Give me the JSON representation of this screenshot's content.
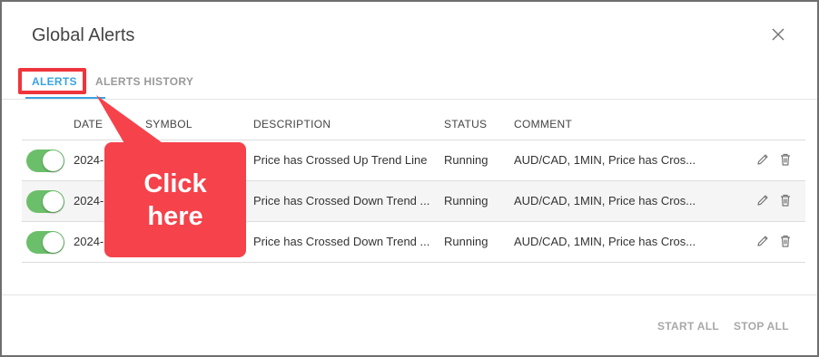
{
  "dialog": {
    "title": "Global Alerts"
  },
  "tabs": [
    {
      "label": "ALERTS",
      "active": true
    },
    {
      "label": "ALERTS HISTORY",
      "active": false
    }
  ],
  "table": {
    "headers": {
      "date": "DATE",
      "symbol": "SYMBOL",
      "description": "DESCRIPTION",
      "status": "STATUS",
      "comment": "COMMENT"
    },
    "rows": [
      {
        "enabled": true,
        "date": "2024-",
        "description": "Price has Crossed Up Trend Line",
        "status": "Running",
        "comment": "AUD/CAD, 1MIN, Price has Cros..."
      },
      {
        "enabled": true,
        "date": "2024-",
        "description": "Price has Crossed Down Trend ...",
        "status": "Running",
        "comment": "AUD/CAD, 1MIN, Price has Cros..."
      },
      {
        "enabled": true,
        "date": "2024-",
        "description": "Price has Crossed Down Trend ...",
        "status": "Running",
        "comment": "AUD/CAD, 1MIN, Price has Cros..."
      }
    ]
  },
  "footer": {
    "start_all": "START ALL",
    "stop_all": "STOP ALL"
  },
  "callout": {
    "line1": "Click",
    "line2": "here"
  },
  "colors": {
    "accent": "#3aa3e3",
    "toggle_on": "#6cbf6a",
    "annotation": "#f5424b"
  },
  "icons": {
    "close": "close-icon",
    "edit": "pencil-icon",
    "delete": "trash-icon"
  }
}
